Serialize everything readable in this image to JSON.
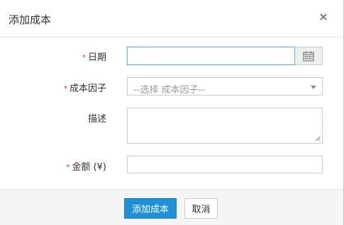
{
  "dialog": {
    "title": "添加成本",
    "close_glyph": "×"
  },
  "form": {
    "required_mark": "*",
    "date_label": "日期",
    "date_value": "",
    "factor_label": "成本因子",
    "factor_placeholder": "--选择 成本因子--",
    "description_label": "描述",
    "description_value": "",
    "amount_label": "金额 (¥)",
    "amount_value": ""
  },
  "footer": {
    "submit_label": "添加成本",
    "cancel_label": "取消"
  },
  "colors": {
    "primary": "#1e90d6",
    "required": "#e02020",
    "focus_border": "#66afe9"
  },
  "icons": {
    "date_picker": "calendar-icon",
    "select_caret": "caret-down-icon",
    "close": "close-icon"
  }
}
